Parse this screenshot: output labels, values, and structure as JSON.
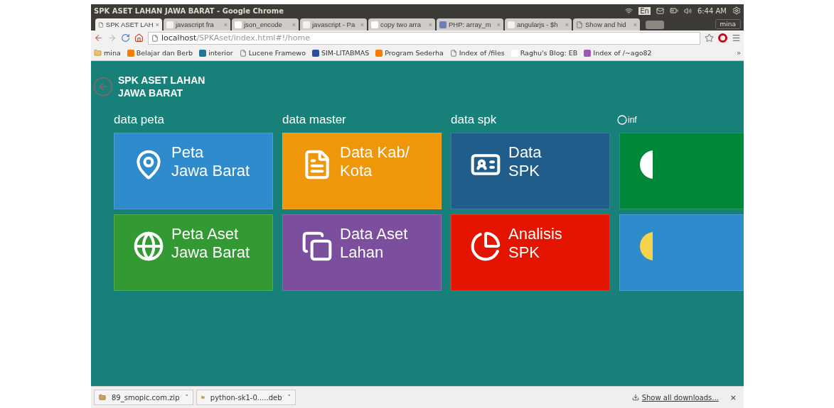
{
  "window": {
    "title": "SPK ASET LAHAN JAWA BARAT - Google Chrome"
  },
  "system_tray": {
    "language": "En",
    "time": "6:44 AM"
  },
  "tabs": [
    {
      "label": "SPK ASET LAH",
      "kind": "page",
      "close": "×",
      "selected": true
    },
    {
      "label": "javascript fra",
      "kind": "so",
      "close": "×",
      "selected": false
    },
    {
      "label": "json_encode",
      "kind": "google",
      "close": "×",
      "selected": false
    },
    {
      "label": "javascript - Pa",
      "kind": "so",
      "close": "×",
      "selected": false
    },
    {
      "label": "copy two arra",
      "kind": "google",
      "close": "×",
      "selected": false
    },
    {
      "label": "PHP: array_m",
      "kind": "php",
      "close": "×",
      "selected": false
    },
    {
      "label": "angularjs - $h",
      "kind": "so",
      "close": "×",
      "selected": false
    },
    {
      "label": "Show and hid",
      "kind": "page",
      "close": "×",
      "selected": false
    }
  ],
  "profile": "mina",
  "address_bar": {
    "host": "localhost",
    "path": "/SPKAset/index.html#!/home"
  },
  "bookmarks": [
    {
      "label": "mina",
      "kind": "folder"
    },
    {
      "label": "Belajar dan Berb",
      "kind": "blogger"
    },
    {
      "label": "interior",
      "kind": "wp"
    },
    {
      "label": "Lucene Framewo",
      "kind": "page"
    },
    {
      "label": "SIM-LITABMAS",
      "kind": "sim"
    },
    {
      "label": "Program Sederha",
      "kind": "blogger"
    },
    {
      "label": "Index of /files",
      "kind": "page"
    },
    {
      "label": "Raghu's Blog: EB",
      "kind": "r"
    },
    {
      "label": "Index of /~ago82",
      "kind": "csnu"
    }
  ],
  "bookmarks_more": "»",
  "app": {
    "title": "SPK ASET LAHAN\nJAWA BARAT",
    "groups": [
      {
        "label": "data peta",
        "tiles": [
          {
            "label": "Peta\nJawa Barat",
            "kind": "pin",
            "color": "#2e8bcc"
          },
          {
            "label": "Peta Aset\nJawa Barat",
            "kind": "globe",
            "color": "#339933"
          }
        ]
      },
      {
        "label": "data master",
        "tiles": [
          {
            "label": "Data Kab/\nKota",
            "kind": "doc",
            "color": "#f09609"
          },
          {
            "label": "Data Aset\nLahan",
            "kind": "copy",
            "color": "#7b4f9d"
          }
        ]
      },
      {
        "label": "data spk",
        "tiles": [
          {
            "label": "Data\nSPK",
            "kind": "idcard",
            "color": "#215d8b"
          },
          {
            "label": "Analisis\nSPK",
            "kind": "pie",
            "color": "#e51400"
          }
        ]
      },
      {
        "label": "inf",
        "kind": "info",
        "tiles": [
          {
            "kind": "white-circle",
            "color": "#00883a"
          },
          {
            "kind": "yellow-circle",
            "color": "#2e8bcc"
          }
        ]
      }
    ]
  },
  "downloads": [
    {
      "name": "89_smopic.com.zip",
      "caret": "˅"
    },
    {
      "name": "python-sk1-0.....deb",
      "caret": "˅"
    }
  ],
  "show_all": "Show all downloads...",
  "downloads_close": "×"
}
